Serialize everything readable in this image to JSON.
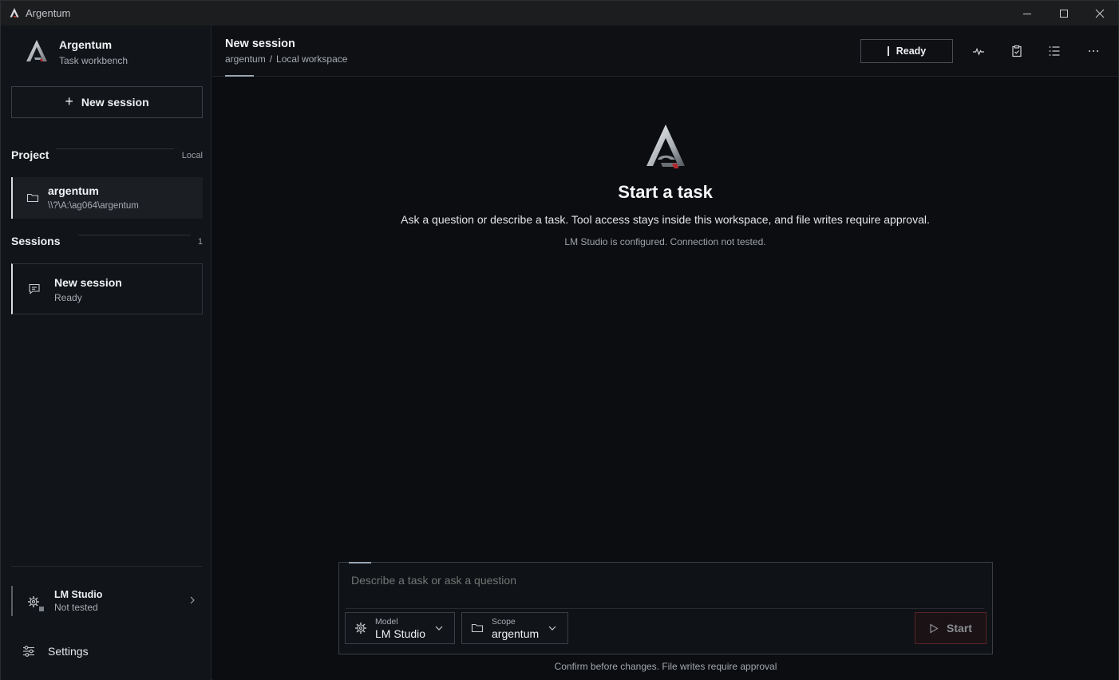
{
  "window": {
    "title": "Argentum"
  },
  "sidebar": {
    "brand_name": "Argentum",
    "brand_subtitle": "Task workbench",
    "new_session_label": "New session",
    "project_section_label": "Project",
    "project_section_meta": "Local",
    "project": {
      "name": "argentum",
      "path": "\\\\?\\A:\\ag064\\argentum"
    },
    "sessions_section_label": "Sessions",
    "sessions_count": "1",
    "sessions": [
      {
        "name": "New session",
        "status": "Ready",
        "icon": "chat-icon"
      }
    ],
    "provider": {
      "name": "LM Studio",
      "status": "Not tested",
      "icon": "gear-icon"
    },
    "settings_label": "Settings"
  },
  "header": {
    "title": "New session",
    "breadcrumb": [
      "argentum",
      "Local workspace"
    ],
    "breadcrumb_separator": "/",
    "status_button": "Ready",
    "icons": [
      "activity-icon",
      "clipboard-icon",
      "list-icon",
      "more-icon"
    ]
  },
  "empty_state": {
    "title": "Start a task",
    "description": "Ask a question or describe a task. Tool access stays inside this workspace, and file writes require approval.",
    "status": "LM Studio is configured. Connection not tested."
  },
  "composer": {
    "placeholder": "Describe a task or ask a question",
    "model_label": "Model",
    "model_value": "LM Studio",
    "scope_label": "Scope",
    "scope_value": "argentum",
    "start_label": "Start",
    "note": "Confirm before changes. File writes require approval"
  },
  "colors": {
    "background": "#0b0d10",
    "sidebar": "#111418",
    "start_border": "#5a2428"
  }
}
